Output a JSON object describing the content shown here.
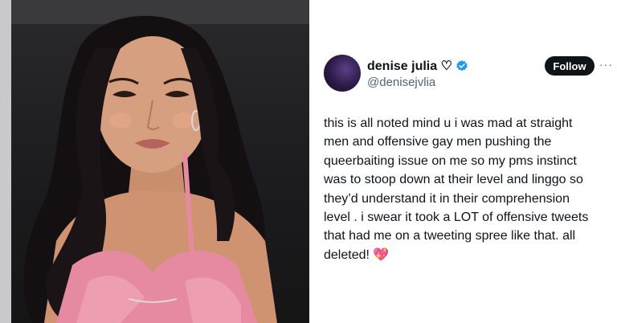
{
  "tweet": {
    "display_name": "denise julia ♡",
    "handle": "@denisejvlia",
    "follow_label": "Follow",
    "more_label": "···",
    "text": "this is all noted mind u i was mad at straight\nmen and offensive gay men pushing the\nqueerbaiting issue on me so my pms instinct\nwas to stoop down at their level and linggo so\nthey’d understand it in their comprehension\nlevel . i swear it took a LOT of offensive tweets\nthat had me on a tweeting spree like that. all\ndeleted! 💖",
    "verified_icon": "verified-badge-icon",
    "verified_color": "#1d9bf0"
  },
  "colors": {
    "text_primary": "#0f1419",
    "text_secondary": "#536471",
    "follow_bg": "#0f1419",
    "photo_shirt": "#e58aa0"
  }
}
